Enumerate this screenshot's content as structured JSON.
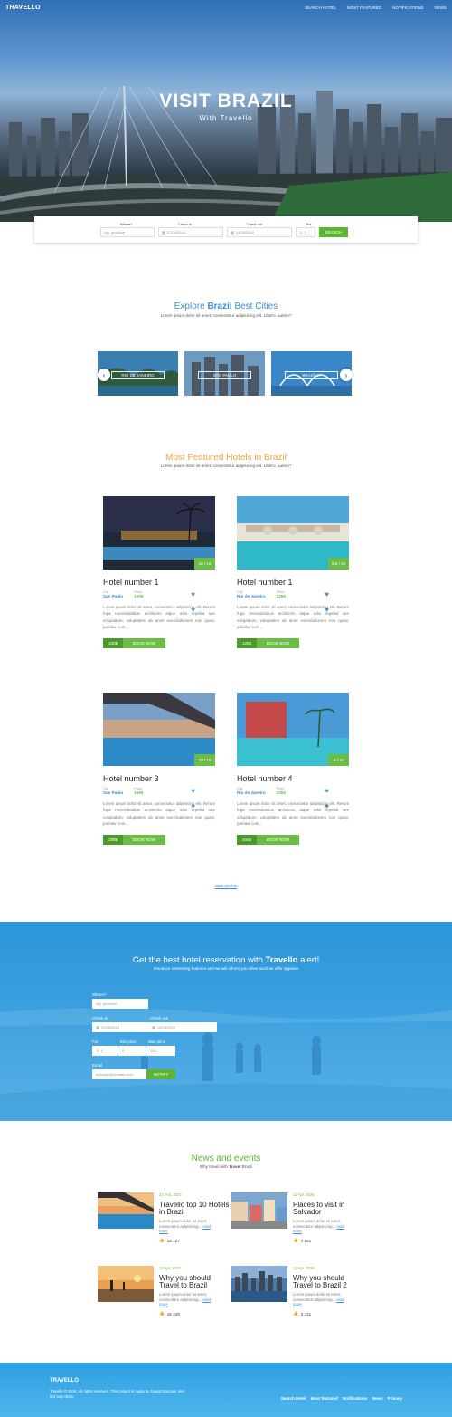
{
  "nav": {
    "logo": "TRAVELLO",
    "links": [
      "SEARCH HOTEL",
      "MOST FEATURED",
      "NOTIFICATIONS",
      "NEWS"
    ]
  },
  "hero": {
    "title": "VISIT BRAZIL",
    "subtitle": "With Travello"
  },
  "search": {
    "where_label": "Where?",
    "where_placeholder": "city, province",
    "checkin_label": "Check in",
    "checkin_value": "07/09/2018",
    "checkout_label": "Check out",
    "checkout_value": "14/09/2018",
    "for_label": "For",
    "for_value": "1",
    "button": "SEARCH"
  },
  "cities": {
    "title_pre": "Explore ",
    "title_bold": "Brazil",
    "title_post": " Best Cities",
    "subtitle": "Lorem ipsum dolor sit amet, consectetur adipisicing elit. Libero, autem?",
    "items": [
      "RIO DE JANEIRO",
      "SÃO PAULO",
      "BRASÍLIA"
    ]
  },
  "featured": {
    "title": "Most Featured Hotels in Brazil",
    "subtitle": "Lorem ipsum dolor sit amet, consectetur adipisicing elit. Libero, autem?",
    "city_key": "City",
    "price_key": "Price",
    "book_label": "BOOK NOW",
    "see_more": "SEE MORE",
    "hotels": [
      {
        "name": "Hotel number 1",
        "score": "10 / 10",
        "city": "Sao Paulo",
        "price": "100$",
        "desc": "Lorem ipsum dolor sit amet, consectetur adipisicing elit. Rerum fuga necessitatibus architecto atque odio repellat iure voluptatum, voluptatem ab amet exercitationem non quasi, pariatur cum..."
      },
      {
        "name": "Hotel number 1",
        "score": "9.5 / 10",
        "city": "Rio de Janeiro",
        "price": "125$",
        "desc": "Lorem ipsum dolor sit amet, consectetur adipisicing elit. Rerum fuga necessitatibus architecto atque odio repellat iure voluptatum, voluptatem ab amet exercitationem non quasi, pariatur cum..."
      },
      {
        "name": "Hotel number 3",
        "score": "10 / 10",
        "city": "Sao Paulo",
        "price": "199$",
        "desc": "Lorem ipsum dolor sit amet, consectetur adipisicing elit. Rerum fuga necessitatibus architecto atque odio repellat iure voluptatum, voluptatem ab amet exercitationem non quasi, pariatur cum..."
      },
      {
        "name": "Hotel number 4",
        "score": "9 / 10",
        "city": "Rio de Janeiro",
        "price": "205$",
        "desc": "Lorem ipsum dolor sit amet, consectetur adipisicing elit. Rerum fuga necessitatibus architecto atque odio repellat iure voluptatum, voluptatem ab amet exercitationem non quasi, pariatur cum..."
      }
    ]
  },
  "alert": {
    "title_pre": "Get the best hotel reservation with ",
    "title_bold": "Travello",
    "title_post": " alert!",
    "subtitle": "Introduce interesting features and we will inform you when such an offer appears",
    "where_label": "Where?",
    "where_placeholder": "city, province",
    "checkin_label": "Check in",
    "checkin_value": "07/09/2018",
    "checkout_label": "Check out",
    "checkout_value": "14/09/2018",
    "for_label": "For",
    "for_value": "1",
    "min_label": "Min price",
    "min_value": "0",
    "max_label": "Max price",
    "max_value": "100",
    "email_label": "Email",
    "email_placeholder": "example@domain.com",
    "button": "NOTIFY"
  },
  "news": {
    "title": "News and events",
    "subtitle_pre": "Why travel with ",
    "subtitle_bold": "Travel",
    "subtitle_post": " Brazil",
    "read_more": "read more",
    "items": [
      {
        "date": "22 Feb, 2017",
        "title": "Travello top 10 Hotels in Brazil",
        "body": "Lorem ipsum dolor sit amet, consectetur adipisicing...",
        "likes": "13 127"
      },
      {
        "date": "12 Apr, 2020",
        "title": "Places to visit in Salvador",
        "body": "Lorem ipsum dolor sit amet, consectetur adipisicing...",
        "likes": "1 821"
      },
      {
        "date": "12 Apr, 2020",
        "title": "Why you should Travel to Brazil",
        "body": "Lorem ipsum dolor sit amet, consectetur adipisicing...",
        "likes": "16 429"
      },
      {
        "date": "12 Apr, 2020",
        "title": "Why you should Travel to Brazil 2",
        "body": "Lorem ipsum dolor sit amet, consectetur adipisicing...",
        "likes": "3 321"
      }
    ]
  },
  "footer": {
    "logo": "TRAVELLO",
    "copyright": "Travello © 2018, All rights reserved. This project is made by Dawid Mazurek and it is only demo",
    "links": [
      "Search Hotel",
      "Most featured",
      "Notifications",
      "News",
      "Privacy"
    ]
  },
  "colors": {
    "accent_blue": "#1a8fd6",
    "accent_green": "#6cbd45",
    "title_orange": "#e8a33d"
  }
}
